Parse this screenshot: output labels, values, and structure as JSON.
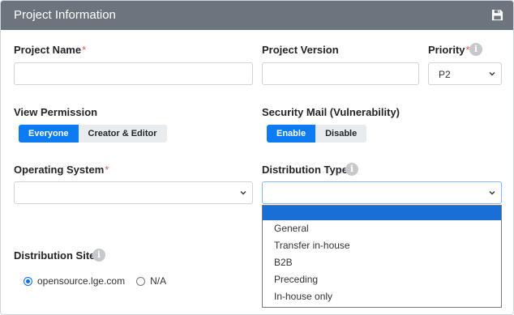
{
  "header": {
    "title": "Project Information",
    "save_icon": "save-icon"
  },
  "fields": {
    "project_name": {
      "label": "Project Name",
      "required_mark": "*",
      "value": ""
    },
    "project_version": {
      "label": "Project Version",
      "value": ""
    },
    "priority": {
      "label": "Priority",
      "required_mark": "*",
      "value": "P2"
    },
    "view_permission": {
      "label": "View Permission",
      "options": [
        "Everyone",
        "Creator & Editor"
      ],
      "selected": "Everyone"
    },
    "security_mail": {
      "label": "Security Mail (Vulnerability)",
      "options": [
        "Enable",
        "Disable"
      ],
      "selected": "Enable"
    },
    "operating_system": {
      "label": "Operating System",
      "required_mark": "*",
      "value": ""
    },
    "distribution_type": {
      "label": "Distribution Type",
      "required_mark": "*",
      "value": "",
      "options": [
        "",
        "General",
        "Transfer in-house",
        "B2B",
        "Preceding",
        "In-house only"
      ]
    },
    "distribution_site": {
      "label": "Distribution Site",
      "required_mark": "*",
      "options": [
        "opensource.lge.com",
        "N/A"
      ],
      "selected": "opensource.lge.com"
    }
  },
  "colors": {
    "header_bg": "#6c757d",
    "accent": "#0d7cf2",
    "required": "#e05555",
    "dropdown_selected": "#1a6fd6"
  }
}
